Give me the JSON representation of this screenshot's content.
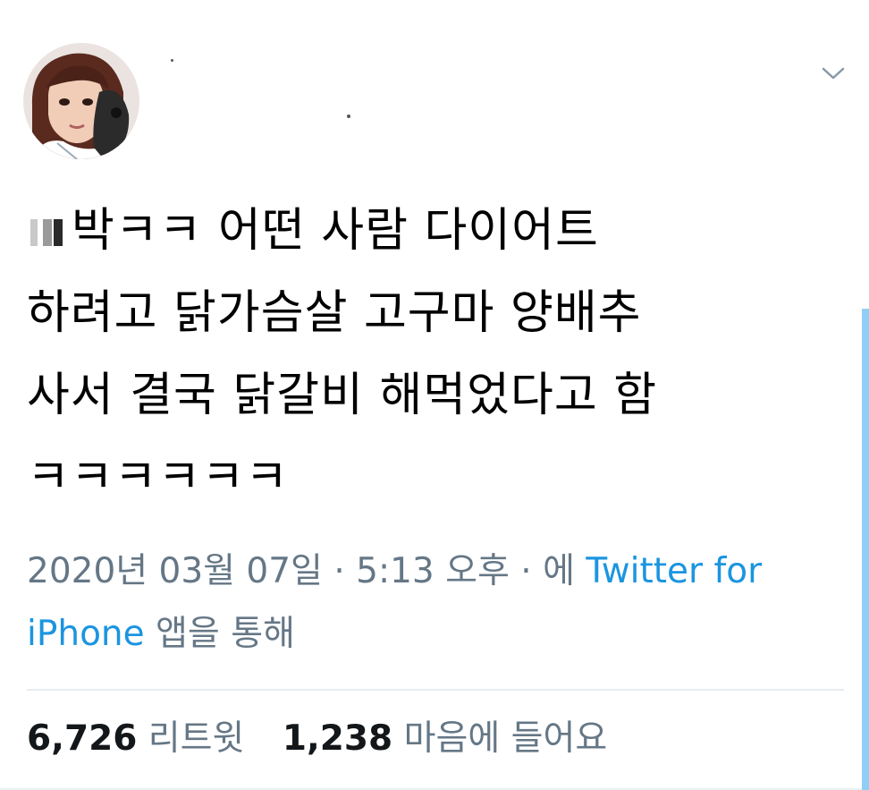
{
  "tweet": {
    "lines": [
      "박ㅋㅋ 어떤 사람 다이어트",
      "하려고 닭가슴살 고구마 양배추",
      "사서 결국 닭갈비 해먹었다고 함",
      "ㅋㅋㅋㅋㅋㅋ"
    ]
  },
  "meta": {
    "date": "2020년 03월 07일",
    "sep1": " · ",
    "time": "5:13 오후",
    "sep2": " · 에 ",
    "source_line1": "Twitter for",
    "source_line2": "iPhone",
    "suffix": " 앱을 통해"
  },
  "stats": {
    "retweets": "6,726",
    "retweets_label": "리트윗",
    "likes": "1,238",
    "likes_label": "마음에 들어요"
  },
  "icons": {
    "menu": "chevron-down-icon",
    "avatar": "avatar"
  },
  "colors": {
    "link": "#1b95e0",
    "meta": "#657786",
    "accent_bar": "#8fcff5"
  }
}
